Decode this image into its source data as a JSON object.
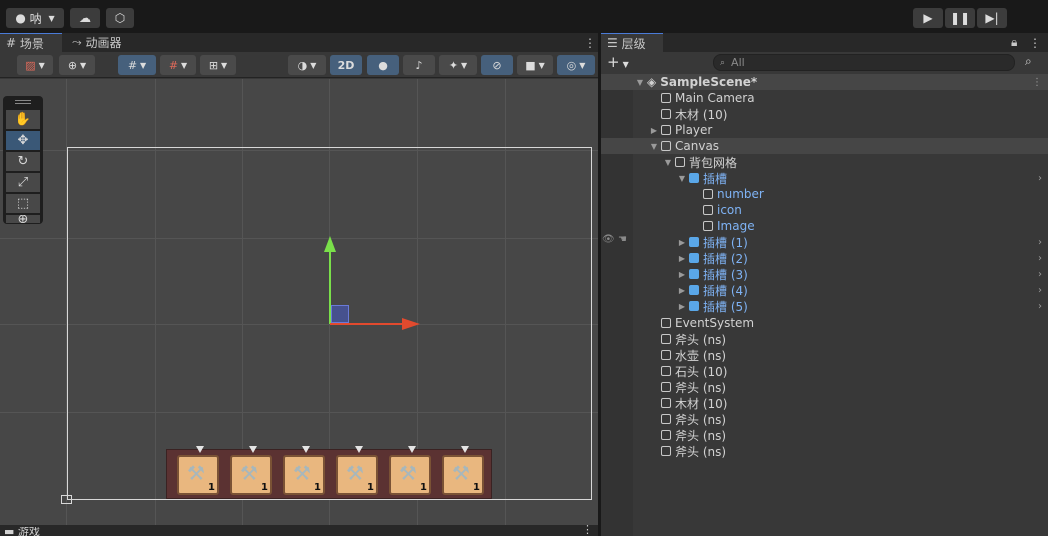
{
  "topbar": {
    "account": "呐",
    "play_icon": "play-icon",
    "pause_icon": "pause-icon",
    "step_icon": "step-icon"
  },
  "scene": {
    "tabs": [
      {
        "label": "场景"
      },
      {
        "label": "动画器"
      }
    ],
    "toolbar": {
      "mode_2d": "2D"
    },
    "slots": [
      {
        "count": "1"
      },
      {
        "count": "1"
      },
      {
        "count": "1"
      },
      {
        "count": "1"
      },
      {
        "count": "1"
      },
      {
        "count": "1"
      }
    ],
    "bottom_tab": "游戏"
  },
  "hierarchy": {
    "tab": "层级",
    "search_placeholder": "All",
    "rows": [
      {
        "label": "SampleScene*"
      },
      {
        "label": "Main Camera"
      },
      {
        "label": "木材 (10)"
      },
      {
        "label": "Player"
      },
      {
        "label": "Canvas"
      },
      {
        "label": "背包网格"
      },
      {
        "label": "插槽"
      },
      {
        "label": "number"
      },
      {
        "label": "icon"
      },
      {
        "label": "Image"
      },
      {
        "label": "插槽 (1)"
      },
      {
        "label": "插槽 (2)"
      },
      {
        "label": "插槽 (3)"
      },
      {
        "label": "插槽 (4)"
      },
      {
        "label": "插槽 (5)"
      },
      {
        "label": "EventSystem"
      },
      {
        "label": "斧头 (ns)"
      },
      {
        "label": "水壶 (ns)"
      },
      {
        "label": "石头 (10)"
      },
      {
        "label": "斧头 (ns)"
      },
      {
        "label": "木材 (10)"
      },
      {
        "label": "斧头 (ns)"
      },
      {
        "label": "斧头 (ns)"
      },
      {
        "label": "斧头 (ns)"
      }
    ]
  },
  "colors": {
    "selection": "#4a7bd8",
    "prefab_blue": "#5aa7e8",
    "axis_y": "#7ae04a",
    "axis_x": "#e24a2e"
  }
}
